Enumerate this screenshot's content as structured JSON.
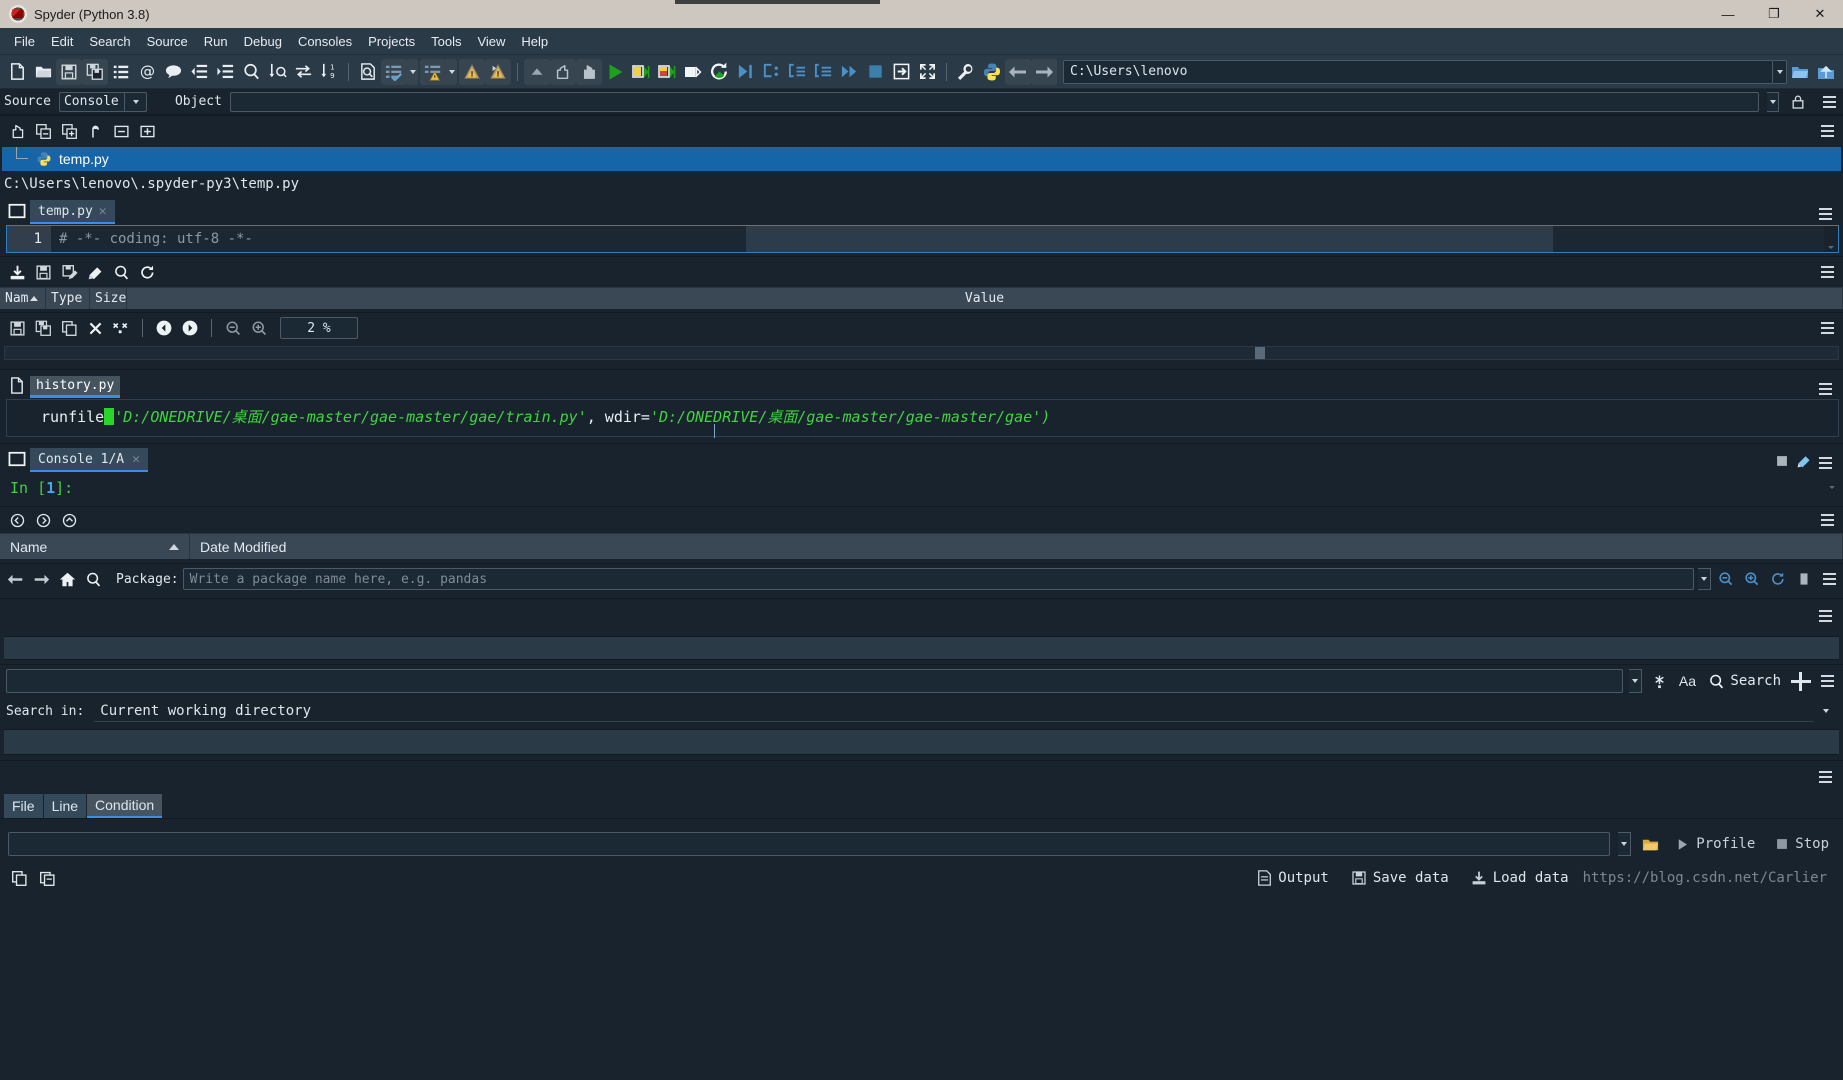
{
  "window": {
    "title": "Spyder (Python 3.8)",
    "minimize": "—",
    "maximize": "❐",
    "close": "✕"
  },
  "menu": {
    "items": [
      "File",
      "Edit",
      "Search",
      "Source",
      "Run",
      "Debug",
      "Consoles",
      "Projects",
      "Tools",
      "View",
      "Help"
    ]
  },
  "toolbar": {
    "path_value": "C:\\Users\\lenovo",
    "icons": [
      "new-file-icon",
      "open-file-icon",
      "save-file-icon",
      "save-all-icon",
      "file-switcher-icon",
      "at-symbol-icon",
      "comment-icon",
      "unindent-icon",
      "indent-icon",
      "find-icon",
      "find-next-icon",
      "replace-icon",
      "goto-line-icon",
      "preview-icon",
      "run-cell-icon",
      "run-cell-advance-icon",
      "debug-file-icon",
      "debug-cell-icon",
      "collapse-icon",
      "undo-icon",
      "redo-icon",
      "run-icon",
      "run-cell-green-icon",
      "run-cell-advance-green-icon",
      "run-selection-icon",
      "rerun-icon",
      "debug-step-icon",
      "debug-continue-icon",
      "step-into-icon",
      "step-return-icon",
      "fast-forward-icon",
      "stop-icon",
      "exit-debug-icon",
      "maximize-pane-icon",
      "preferences-icon",
      "pythonpath-icon",
      "back-icon",
      "forward-icon",
      "browse-folder-icon",
      "up-folder-icon"
    ]
  },
  "help_pane": {
    "source_label": "Source",
    "source_value": "Console",
    "object_label": "Object",
    "object_value": "",
    "lock_icon": "lock-icon",
    "options_icon": "options-menu-icon"
  },
  "project_pane": {
    "toolbar_icons": [
      "new-project-icon",
      "collapse-selection-icon",
      "expand-selection-icon",
      "restore-icon",
      "collapse-all-icon",
      "expand-all-icon"
    ],
    "tree": [
      {
        "label": "temp.py",
        "icon": "python-file-icon",
        "selected": true
      }
    ]
  },
  "editor": {
    "file_path": "C:\\Users\\lenovo\\.spyder-py3\\temp.py",
    "tab_label": "temp.py",
    "tab_close": "✕",
    "browse_icon": "browse-tabs-icon",
    "lines": [
      {
        "number": "1",
        "text": "# -*- coding: utf-8 -*-"
      }
    ],
    "options_icon": "options-menu-icon"
  },
  "variable_explorer": {
    "toolbar_icons": [
      "import-data-icon",
      "save-data-icon",
      "save-data-as-icon",
      "remove-all-icon",
      "search-icon",
      "refresh-icon"
    ],
    "columns": [
      "Nam",
      "Type",
      "Size",
      "Value"
    ],
    "sort_indicator": "sort-ascending-icon",
    "rows": [],
    "options_icon": "options-menu-icon"
  },
  "plots_pane": {
    "toolbar_icons": [
      "save-plot-icon",
      "save-all-plots-icon",
      "copy-plot-icon",
      "remove-plot-icon",
      "remove-all-plots-icon",
      "previous-plot-icon",
      "next-plot-icon",
      "zoom-out-icon",
      "zoom-in-icon"
    ],
    "zoom_value": "2 %",
    "options_icon": "options-menu-icon"
  },
  "history": {
    "tab_label": "history.py",
    "tab_icon": "history-file-icon",
    "entry": {
      "func": "runfile",
      "open_paren": "(",
      "arg1": "'D:/ONEDRIVE/桌面/gae-master/gae-master/gae/train.py'",
      "separator": ", ",
      "kw": "wdir=",
      "arg2": "'D:/ONEDRIVE/桌面/gae-master/gae-master/gae'",
      "close_paren": ")"
    },
    "options_icon": "options-menu-icon"
  },
  "console": {
    "tab_label": "Console 1/A",
    "tab_close": "✕",
    "tab_icon": "console-icon",
    "prompt_prefix": "In [",
    "prompt_number": "1",
    "prompt_suffix": "]:",
    "stop_icon": "stop-icon",
    "clear_icon": "clear-console-icon",
    "options_icon": "options-menu-icon"
  },
  "file_explorer": {
    "toolbar_icons": [
      "previous-dir-icon",
      "next-dir-icon",
      "parent-dir-icon"
    ],
    "columns": [
      "Name",
      "Date Modified"
    ],
    "sort_indicator": "sort-ascending-icon",
    "options_icon": "options-menu-icon"
  },
  "online_help": {
    "nav_icons": [
      "back-icon",
      "forward-icon",
      "home-icon",
      "find-icon"
    ],
    "package_label": "Package:",
    "package_placeholder": "Write a package name here, e.g. pandas",
    "package_value": "",
    "right_icons": [
      "zoom-out-icon",
      "zoom-in-icon",
      "refresh-icon",
      "stop-icon"
    ],
    "options_icon": "options-menu-icon"
  },
  "find_pane": {
    "search_value": "",
    "regex_icon": "regex-icon",
    "case_label": "Aa",
    "search_icon": "search-icon",
    "search_label": "Search",
    "add_icon": "plus-icon",
    "options_icon": "options-menu-icon",
    "search_in_label": "Search in:",
    "search_in_value": "Current working directory"
  },
  "breakpoints": {
    "tabs": [
      "File",
      "Line",
      "Condition"
    ],
    "active_tab": "Condition",
    "options_icon": "options-menu-icon"
  },
  "profiler": {
    "input_value": "",
    "browse_icon": "browse-file-icon",
    "profile_label": "Profile",
    "profile_icon": "run-profile-icon",
    "stop_label": "Stop",
    "stop_icon": "stop-square-icon"
  },
  "status": {
    "left_icons": [
      "copy-icon",
      "paste-icon"
    ],
    "output_label": "Output",
    "output_icon": "output-icon",
    "save_data_label": "Save data",
    "save_data_icon": "save-icon",
    "load_data_label": "Load data",
    "load_data_icon": "load-icon",
    "watermark": "https://blog.csdn.net/Carlier"
  },
  "colors": {
    "bg": "#19232d",
    "panel": "#2b3a47",
    "accent": "#3a8ee6",
    "selection": "#1565a8",
    "titlebar": "#cdc7bf",
    "green": "#3fd43f",
    "text": "#dfe6ec"
  }
}
